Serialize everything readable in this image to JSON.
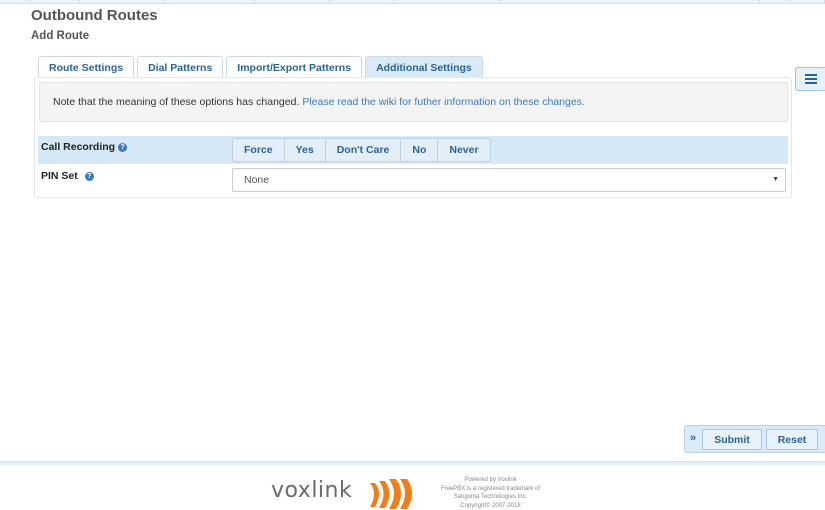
{
  "page": {
    "title": "Outbound Routes",
    "subtitle": "Add Route"
  },
  "tabs": [
    {
      "label": "Route Settings",
      "active": false
    },
    {
      "label": "Dial Patterns",
      "active": false
    },
    {
      "label": "Import/Export Patterns",
      "active": false
    },
    {
      "label": "Additional Settings",
      "active": true
    }
  ],
  "notice": {
    "text": "Note that the meaning of these options has changed.",
    "link": "Please read the wiki for futher information on these changes."
  },
  "call_recording": {
    "label": "Call Recording",
    "help_icon": "question-circle-icon",
    "options": [
      "Force",
      "Yes",
      "Don't Care",
      "No",
      "Never"
    ]
  },
  "pin_set": {
    "label": "PIN Set",
    "help_icon": "question-circle-icon",
    "value": "None"
  },
  "actions": {
    "collapse_icon": "»",
    "submit": "Submit",
    "reset": "Reset"
  },
  "side_menu_icon": "list-icon",
  "footer": {
    "logo": "voxlink",
    "lines": [
      "Powered by Voxlink",
      "FreePBX is a registered trademark of",
      "Sangoma Technologies Inc.",
      "Copyright© 2007-2018"
    ]
  },
  "colors": {
    "accent": "#2a6496",
    "tab_active_bg": "#daeaf7",
    "row_bg": "#d6e8f6",
    "logo_orange": "#f07d1a"
  }
}
